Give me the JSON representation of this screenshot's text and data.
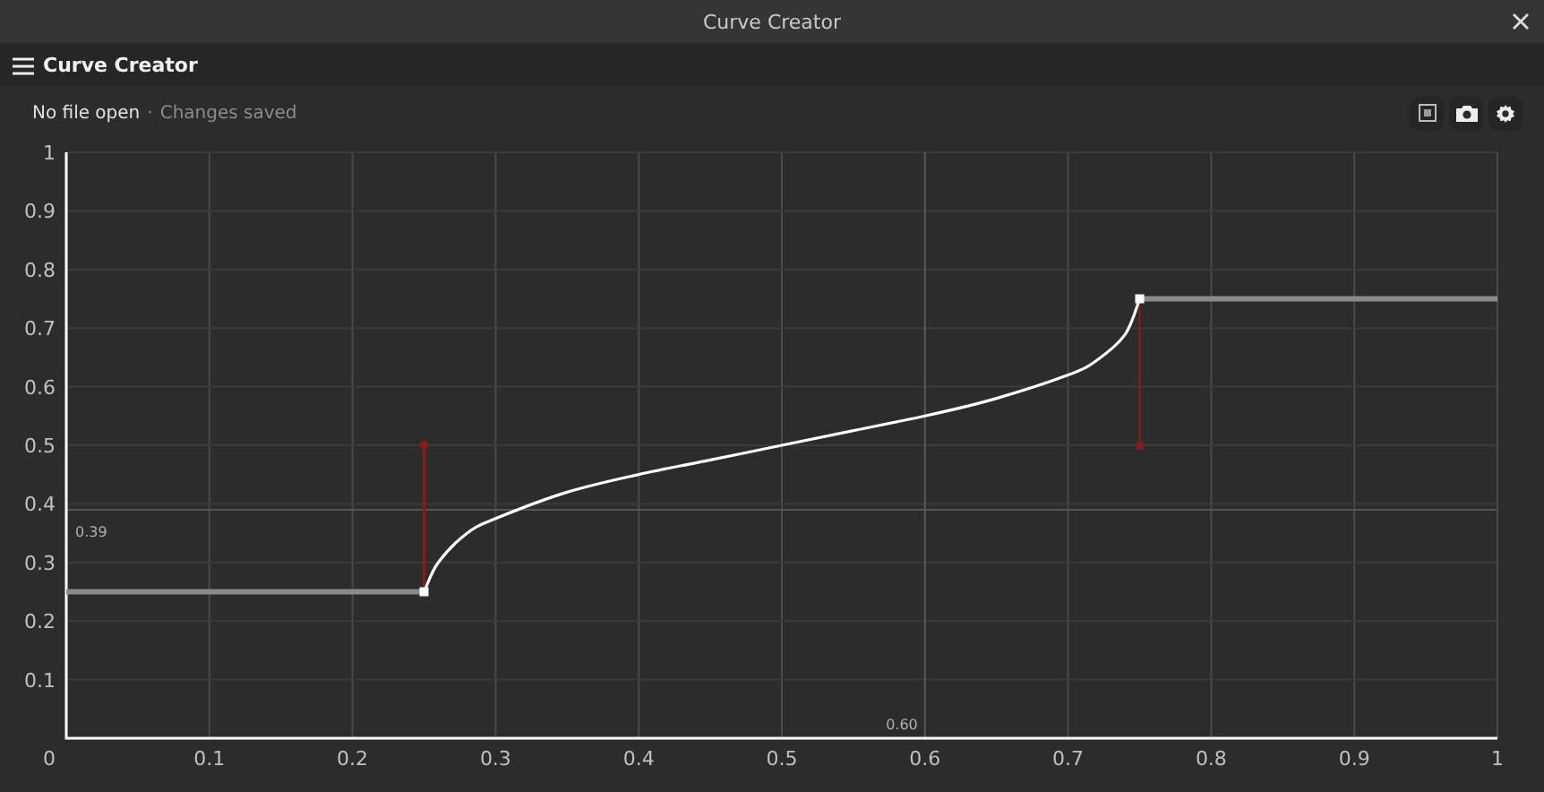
{
  "window": {
    "title": "Curve Creator"
  },
  "header": {
    "title": "Curve Creator"
  },
  "status": {
    "file": "No file open",
    "separator": "·",
    "saved": "Changes saved"
  },
  "toolbar": [
    {
      "kind": "frame"
    },
    {
      "kind": "camera"
    },
    {
      "kind": "settings"
    }
  ],
  "origin_label": "0",
  "chart_data": {
    "type": "line",
    "grid": true,
    "x": [
      0,
      0.25,
      0.26,
      0.28,
      0.3,
      0.35,
      0.4,
      0.45,
      0.5,
      0.55,
      0.6,
      0.65,
      0.7,
      0.72,
      0.74,
      0.75,
      1
    ],
    "series": [
      {
        "color": "#8a8a8a",
        "values": [
          0.25,
          0.25,
          null,
          null,
          null,
          null,
          null,
          null,
          null,
          null,
          null,
          null,
          null,
          null,
          null,
          0.75,
          0.75
        ]
      },
      {
        "color": "#ffffff",
        "values": [
          null,
          0.25,
          0.3,
          0.35,
          0.375,
          0.42,
          0.45,
          0.475,
          0.5,
          0.525,
          0.55,
          0.58,
          0.62,
          0.645,
          0.69,
          0.75,
          null
        ]
      }
    ],
    "ref_lines": [
      {
        "axis": "x",
        "value": 0.6,
        "label": "0.60"
      },
      {
        "axis": "y",
        "value": 0.39,
        "label": "0.39"
      }
    ],
    "xlim": [
      0,
      1
    ],
    "ylim": [
      0,
      1
    ],
    "xticks": [
      0.1,
      0.2,
      0.3,
      0.4,
      0.5,
      0.6,
      0.7,
      0.8,
      0.9,
      {
        "value": 1,
        "label": "1"
      }
    ],
    "yticks": [
      0.1,
      0.2,
      0.3,
      0.4,
      0.5,
      0.6,
      0.7,
      0.8,
      0.9,
      {
        "value": 1,
        "label": "1"
      }
    ]
  }
}
